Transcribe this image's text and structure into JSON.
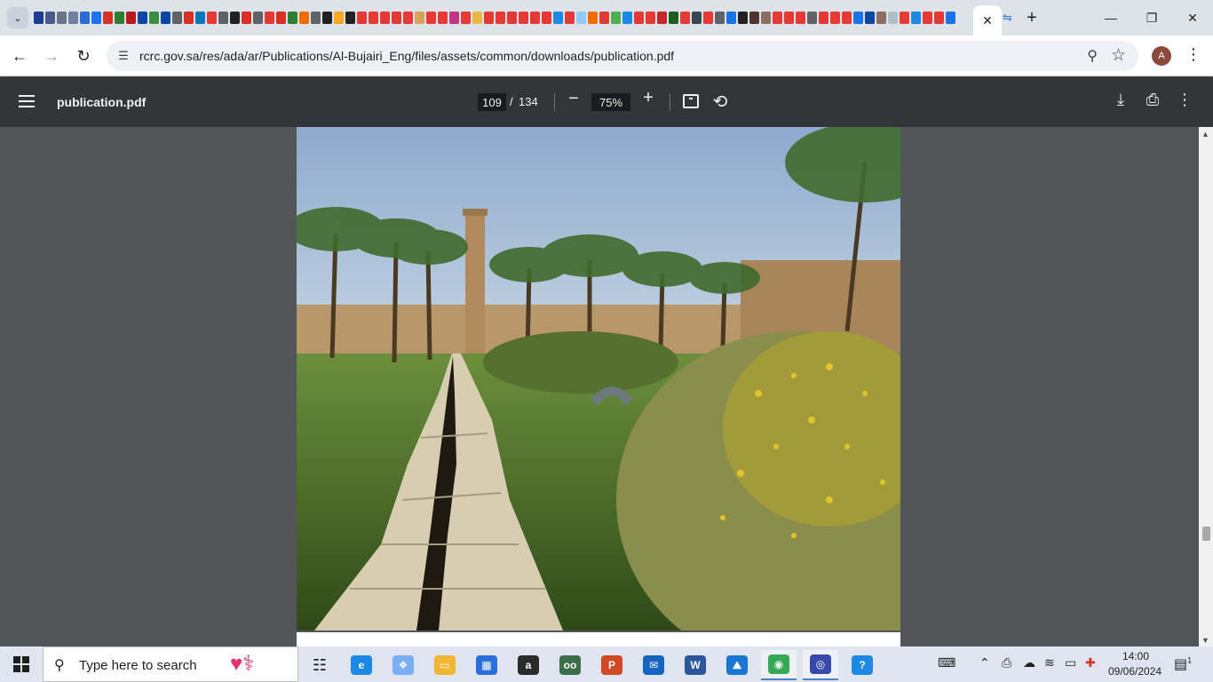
{
  "browser": {
    "address": {
      "url": "rcrc.gov.sa/res/ada/ar/Publications/Al-Bujairi_Eng/files/assets/common/downloads/publication.pdf"
    },
    "profile_initial": "A",
    "favicon_colors": [
      "#1b3d8f",
      "#4a5a8a",
      "#6a7688",
      "#6e7fa0",
      "#2b6cd6",
      "#1a73e8",
      "#d93025",
      "#2e7d32",
      "#b71c1c",
      "#0d47a1",
      "#388e3c",
      "#0d47a1",
      "#5f6368",
      "#d93025",
      "#0277bd",
      "#e53935",
      "#5f6368",
      "#212121",
      "#d93025",
      "#5f6368",
      "#e53935",
      "#d93025",
      "#2e7d32",
      "#ef6c00",
      "#5f6368",
      "#212121",
      "#f9a825",
      "#212121",
      "#e53935",
      "#e53935",
      "#e53935",
      "#e53935",
      "#e53935",
      "#d7a25c",
      "#e53935",
      "#e53935",
      "#c13584",
      "#e53935",
      "#e6b84a",
      "#e53935",
      "#e53935",
      "#e53935",
      "#e53935",
      "#e53935",
      "#e53935",
      "#1e88e5",
      "#e53935",
      "#90caf9",
      "#ef6c00",
      "#e53935",
      "#4caf50",
      "#1e88e5",
      "#e53935",
      "#e53935",
      "#c62828",
      "#1b5e20",
      "#e53935",
      "#37474f",
      "#e53935",
      "#5f6368",
      "#1a73e8",
      "#212121",
      "#4e342e",
      "#8d6e63",
      "#e53935",
      "#e53935",
      "#e53935",
      "#5f6368",
      "#e53935",
      "#e53935",
      "#e53935",
      "#1a73e8",
      "#0d47a1",
      "#8d6e63",
      "#b0bec5",
      "#e53935",
      "#1e88e5",
      "#e53935",
      "#e53935",
      "#1a73e8"
    ]
  },
  "pdf": {
    "title": "publication.pdf",
    "current_page": "109",
    "page_separator": "/",
    "total_pages": "134",
    "zoom": "75%"
  },
  "taskbar": {
    "search_placeholder": "Type here to search",
    "apps": [
      {
        "name": "task-view",
        "glyph": "☷"
      },
      {
        "name": "edge",
        "glyph": "e",
        "color": "#1e88e5"
      },
      {
        "name": "dropbox",
        "glyph": "❖",
        "color": "#7aaef5"
      },
      {
        "name": "file-explorer",
        "glyph": "▭",
        "color": "#f2b632"
      },
      {
        "name": "microsoft-store",
        "glyph": "▦",
        "color": "#2a6fdb"
      },
      {
        "name": "amazon",
        "glyph": "a",
        "color": "#2b2b2b"
      },
      {
        "name": "tripadvisor",
        "glyph": "oo",
        "color": "#3c6e47"
      },
      {
        "name": "powerpoint",
        "glyph": "P",
        "color": "#d24726"
      },
      {
        "name": "mail",
        "glyph": "✉",
        "color": "#1565c0"
      },
      {
        "name": "word",
        "glyph": "W",
        "color": "#2b579a"
      },
      {
        "name": "photos",
        "glyph": "⛰",
        "color": "#1976d2"
      },
      {
        "name": "chrome",
        "glyph": "◉",
        "color": "#34a853"
      },
      {
        "name": "vpn",
        "glyph": "◎",
        "color": "#3949ab"
      },
      {
        "name": "help",
        "glyph": "?",
        "color": "#1e88e5"
      }
    ],
    "clock_time": "14:00",
    "clock_date": "09/06/2024",
    "notification_count": "1"
  }
}
